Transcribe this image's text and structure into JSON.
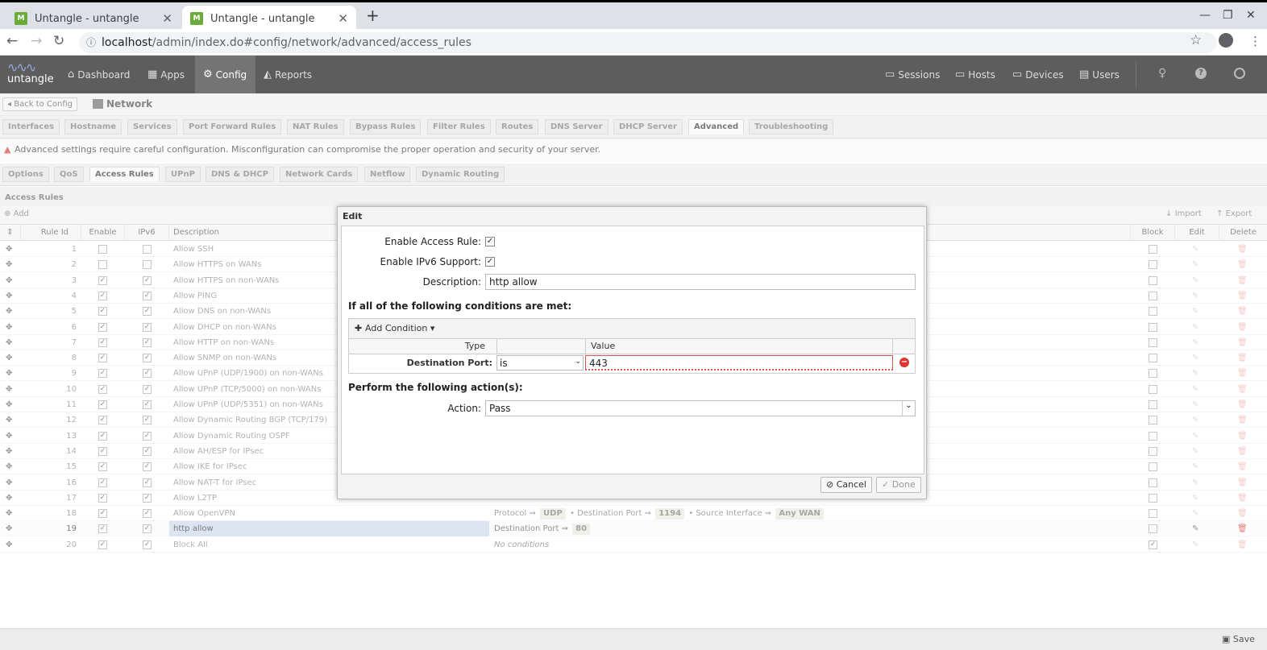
{
  "browser": {
    "tabs": [
      {
        "title": "Untangle - untangle"
      },
      {
        "title": "Untangle - untangle"
      }
    ],
    "url_host": "localhost",
    "url_path": "/admin/index.do#config/network/advanced/access_rules"
  },
  "app": {
    "logo_text": "untangle",
    "nav": [
      {
        "label": "Dashboard"
      },
      {
        "label": "Apps"
      },
      {
        "label": "Config"
      },
      {
        "label": "Reports"
      }
    ],
    "right_nav": [
      {
        "label": "Sessions"
      },
      {
        "label": "Hosts"
      },
      {
        "label": "Devices"
      },
      {
        "label": "Users"
      }
    ]
  },
  "crumb": {
    "back_label": "Back to Config",
    "page_title": "Network"
  },
  "network_tabs": [
    "Interfaces",
    "Hostname",
    "Services",
    "Port Forward Rules",
    "NAT Rules",
    "Bypass Rules",
    "Filter Rules",
    "Routes",
    "DNS Server",
    "DHCP Server",
    "Advanced",
    "Troubleshooting"
  ],
  "warning": "Advanced settings require careful configuration. Misconfiguration can compromise the proper operation and security of your server.",
  "advanced_tabs": [
    "Options",
    "QoS",
    "Access Rules",
    "UPnP",
    "DNS & DHCP",
    "Network Cards",
    "Netflow",
    "Dynamic Routing"
  ],
  "grid": {
    "title": "Access Rules",
    "add_label": "Add",
    "import_label": "Import",
    "export_label": "Export",
    "columns": {
      "rule_id": "Rule Id",
      "enable": "Enable",
      "ipv6": "IPv6",
      "description": "Description",
      "block": "Block",
      "edit": "Edit",
      "delete": "Delete"
    },
    "rows": [
      {
        "id": "1",
        "enable": false,
        "ipv6": false,
        "desc": "Allow SSH",
        "block": false
      },
      {
        "id": "2",
        "enable": false,
        "ipv6": false,
        "desc": "Allow HTTPS on WANs",
        "block": false
      },
      {
        "id": "3",
        "enable": true,
        "ipv6": true,
        "desc": "Allow HTTPS on non-WANs",
        "block": false
      },
      {
        "id": "4",
        "enable": true,
        "ipv6": true,
        "desc": "Allow PING",
        "block": false
      },
      {
        "id": "5",
        "enable": true,
        "ipv6": true,
        "desc": "Allow DNS on non-WANs",
        "block": false
      },
      {
        "id": "6",
        "enable": true,
        "ipv6": true,
        "desc": "Allow DHCP on non-WANs",
        "block": false
      },
      {
        "id": "7",
        "enable": true,
        "ipv6": true,
        "desc": "Allow HTTP on non-WANs",
        "block": false
      },
      {
        "id": "8",
        "enable": true,
        "ipv6": true,
        "desc": "Allow SNMP on non-WANs",
        "block": false
      },
      {
        "id": "9",
        "enable": true,
        "ipv6": true,
        "desc": "Allow UPnP (UDP/1900) on non-WANs",
        "block": false
      },
      {
        "id": "10",
        "enable": true,
        "ipv6": true,
        "desc": "Allow UPnP (TCP/5000) on non-WANs",
        "block": false
      },
      {
        "id": "11",
        "enable": true,
        "ipv6": true,
        "desc": "Allow UPnP (UDP/5351) on non-WANs",
        "block": false
      },
      {
        "id": "12",
        "enable": true,
        "ipv6": true,
        "desc": "Allow Dynamic Routing BGP (TCP/179)",
        "block": false
      },
      {
        "id": "13",
        "enable": true,
        "ipv6": true,
        "desc": "Allow Dynamic Routing OSPF",
        "block": false
      },
      {
        "id": "14",
        "enable": true,
        "ipv6": true,
        "desc": "Allow AH/ESP for IPsec",
        "block": false
      },
      {
        "id": "15",
        "enable": true,
        "ipv6": true,
        "desc": "Allow IKE for IPsec",
        "block": false
      },
      {
        "id": "16",
        "enable": true,
        "ipv6": true,
        "desc": "Allow NAT-T for IPsec",
        "block": false
      },
      {
        "id": "17",
        "enable": true,
        "ipv6": true,
        "desc": "Allow L2TP",
        "block": false
      },
      {
        "id": "18",
        "enable": true,
        "ipv6": true,
        "desc": "Allow OpenVPN",
        "block": false
      },
      {
        "id": "19",
        "enable": true,
        "ipv6": true,
        "desc": "http allow",
        "block": false
      },
      {
        "id": "20",
        "enable": true,
        "ipv6": true,
        "desc": "Block All",
        "block": true
      }
    ],
    "row18_conditions": {
      "p1": "Protocol ⇒",
      "v1": "UDP",
      "p2": "Destination Port ⇒",
      "v2": "1194",
      "p3": "Source Interface ⇒",
      "v3": "Any WAN"
    },
    "row19_conditions": {
      "p1": "Destination Port ⇒",
      "v1": "80"
    },
    "row20_conditions": "No conditions"
  },
  "dialog": {
    "title": "Edit",
    "enable_label": "Enable Access Rule:",
    "ipv6_label": "Enable IPv6 Support:",
    "description_label": "Description:",
    "description_value": "http allow",
    "conditions_heading": "If all of the following conditions are met:",
    "add_condition_label": "Add Condition",
    "col_type": "Type",
    "col_value": "Value",
    "condition": {
      "type_label": "Destination Port:",
      "operator": "is",
      "value": "443"
    },
    "actions_heading": "Perform the following action(s):",
    "action_label": "Action:",
    "action_value": "Pass",
    "cancel_label": "Cancel",
    "done_label": "Done"
  },
  "status": {
    "save_label": "Save"
  }
}
